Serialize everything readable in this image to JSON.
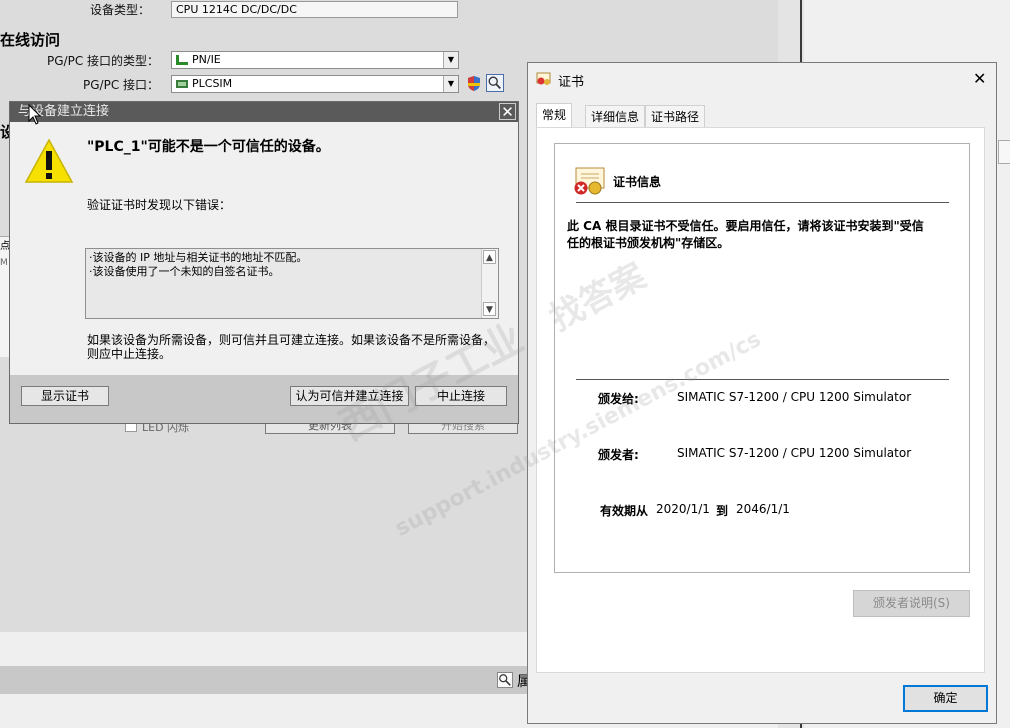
{
  "background": {
    "device_type_label": "设备类型：",
    "device_type_value": "CPU 1214C DC/DC/DC",
    "section_online": "在线访问",
    "pgpc_type_label": "PG/PC 接口的类型：",
    "pgpc_type_value": "PN/IE",
    "pgpc_interface_label": "PG/PC 接口：",
    "pgpc_interface_value": "PLCSIM",
    "left_fragment_1": "设",
    "left_fragment_2": "点",
    "left_fragment_3": "M",
    "led_checkbox_label": "LED 闪烁",
    "update_list_button": "更新列表",
    "start_search_button": "开始搜索",
    "bottom_tab_fragment": "属"
  },
  "connect_dialog": {
    "title": "与设备建立连接",
    "heading": "\"PLC_1\"可能不是一个可信任的设备。",
    "intro": "验证证书时发现以下错误：",
    "errors": [
      "·该设备的 IP 地址与相关证书的地址不匹配。",
      "·该设备使用了一个未知的自签名证书。"
    ],
    "advice_line1": "如果该设备为所需设备，则可信并且可建立连接。如果该设备不是所需设备，",
    "advice_line2": "则应中止连接。",
    "show_cert_button": "显示证书",
    "trust_connect_button": "认为可信并建立连接",
    "abort_button": "中止连接"
  },
  "cert_window": {
    "title": "证书",
    "tabs": [
      "常规",
      "详细信息",
      "证书路径"
    ],
    "info_heading": "证书信息",
    "warning_line1": "此 CA 根目录证书不受信任。要启用信任，请将该证书安装到\"受信",
    "warning_line2": "任的根证书颁发机构\"存储区。",
    "issued_to_label": "颁发给:",
    "issued_to_value": "SIMATIC S7-1200 / CPU 1200 Simulator",
    "issued_by_label": "颁发者:",
    "issued_by_value": "SIMATIC S7-1200 / CPU 1200 Simulator",
    "valid_from_label": "有效期从",
    "valid_from_value": "2020/1/1",
    "valid_to_label": "到",
    "valid_to_value": "2046/1/1",
    "issuer_statement_button": "颁发者说明(S)",
    "ok_button": "确定"
  },
  "watermark": {
    "line1": "西门子工业",
    "line2": "support.industry.siemens.com/cs",
    "line3": "找答案"
  },
  "colors": {
    "warning_yellow": "#f5e000",
    "dialog_titlebar": "#5a5a5a",
    "ok_button_border": "#0078d7"
  }
}
